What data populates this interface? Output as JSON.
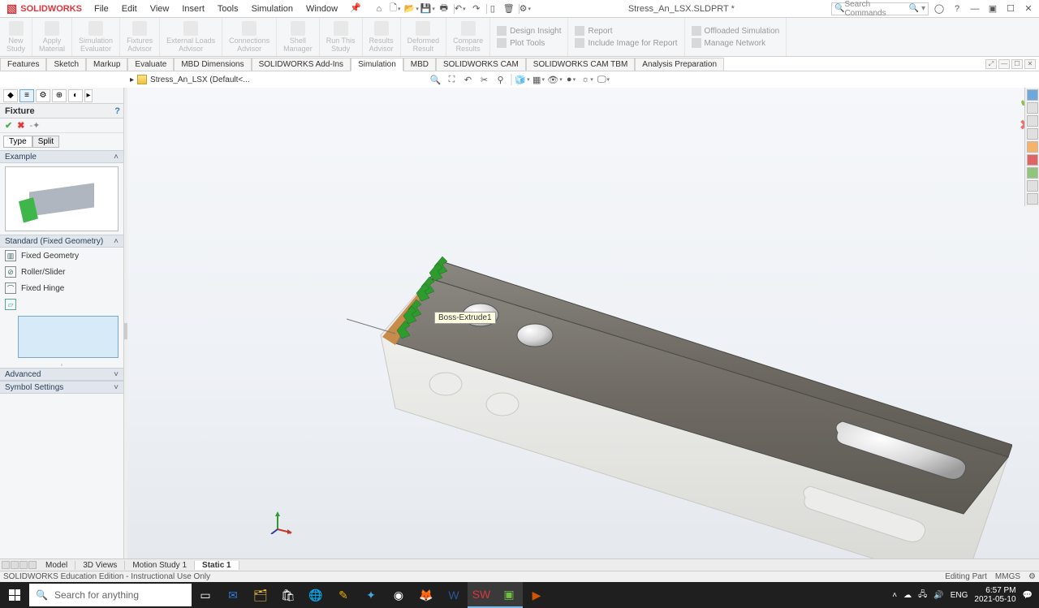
{
  "app": {
    "brand": "SOLIDWORKS",
    "doc_title": "Stress_An_LSX.SLDPRT *",
    "search_placeholder": "Search Commands"
  },
  "menu": [
    "File",
    "Edit",
    "View",
    "Insert",
    "Tools",
    "Simulation",
    "Window"
  ],
  "ribbon_large": [
    {
      "label": "New\nStudy"
    },
    {
      "label": "Apply\nMaterial"
    },
    {
      "label": "Simulation\nEvaluator"
    },
    {
      "label": "Fixtures\nAdvisor"
    },
    {
      "label": "External Loads\nAdvisor"
    },
    {
      "label": "Connections\nAdvisor"
    },
    {
      "label": "Shell\nManager"
    },
    {
      "label": "Run This\nStudy"
    },
    {
      "label": "Results\nAdvisor"
    },
    {
      "label": "Deformed\nResult"
    },
    {
      "label": "Compare\nResults"
    }
  ],
  "ribbon_stack1": [
    "Design Insight",
    "Plot Tools"
  ],
  "ribbon_stack2": [
    "Report",
    "Include Image for Report"
  ],
  "ribbon_stack3": [
    "Offloaded Simulation",
    "Manage Network"
  ],
  "cmd_tabs": [
    "Features",
    "Sketch",
    "Markup",
    "Evaluate",
    "MBD Dimensions",
    "SOLIDWORKS Add-Ins",
    "Simulation",
    "MBD",
    "SOLIDWORKS CAM",
    "SOLIDWORKS CAM TBM",
    "Analysis Preparation"
  ],
  "cmd_active": "Simulation",
  "breadcrumb": "Stress_An_LSX  (Default<...",
  "panel": {
    "title": "Fixture",
    "type_tabs": [
      "Type",
      "Split"
    ],
    "type_active": "Type",
    "sec_example": "Example",
    "sec_standard": "Standard (Fixed Geometry)",
    "radios": [
      "Fixed Geometry",
      "Roller/Slider",
      "Fixed Hinge"
    ],
    "sec_advanced": "Advanced",
    "sec_symbol": "Symbol Settings"
  },
  "viewport": {
    "tooltip": "Boss-Extrude1"
  },
  "bottom_tabs": [
    "Model",
    "3D Views",
    "Motion Study 1",
    "Static 1"
  ],
  "bottom_active": "Static 1",
  "status": {
    "left": "SOLIDWORKS Education Edition - Instructional Use Only",
    "right": "Editing Part",
    "mmgs": "MMGS"
  },
  "taskbar": {
    "search": "Search for anything",
    "lang": "ENG",
    "time": "6:57 PM",
    "date": "2021-05-10"
  }
}
